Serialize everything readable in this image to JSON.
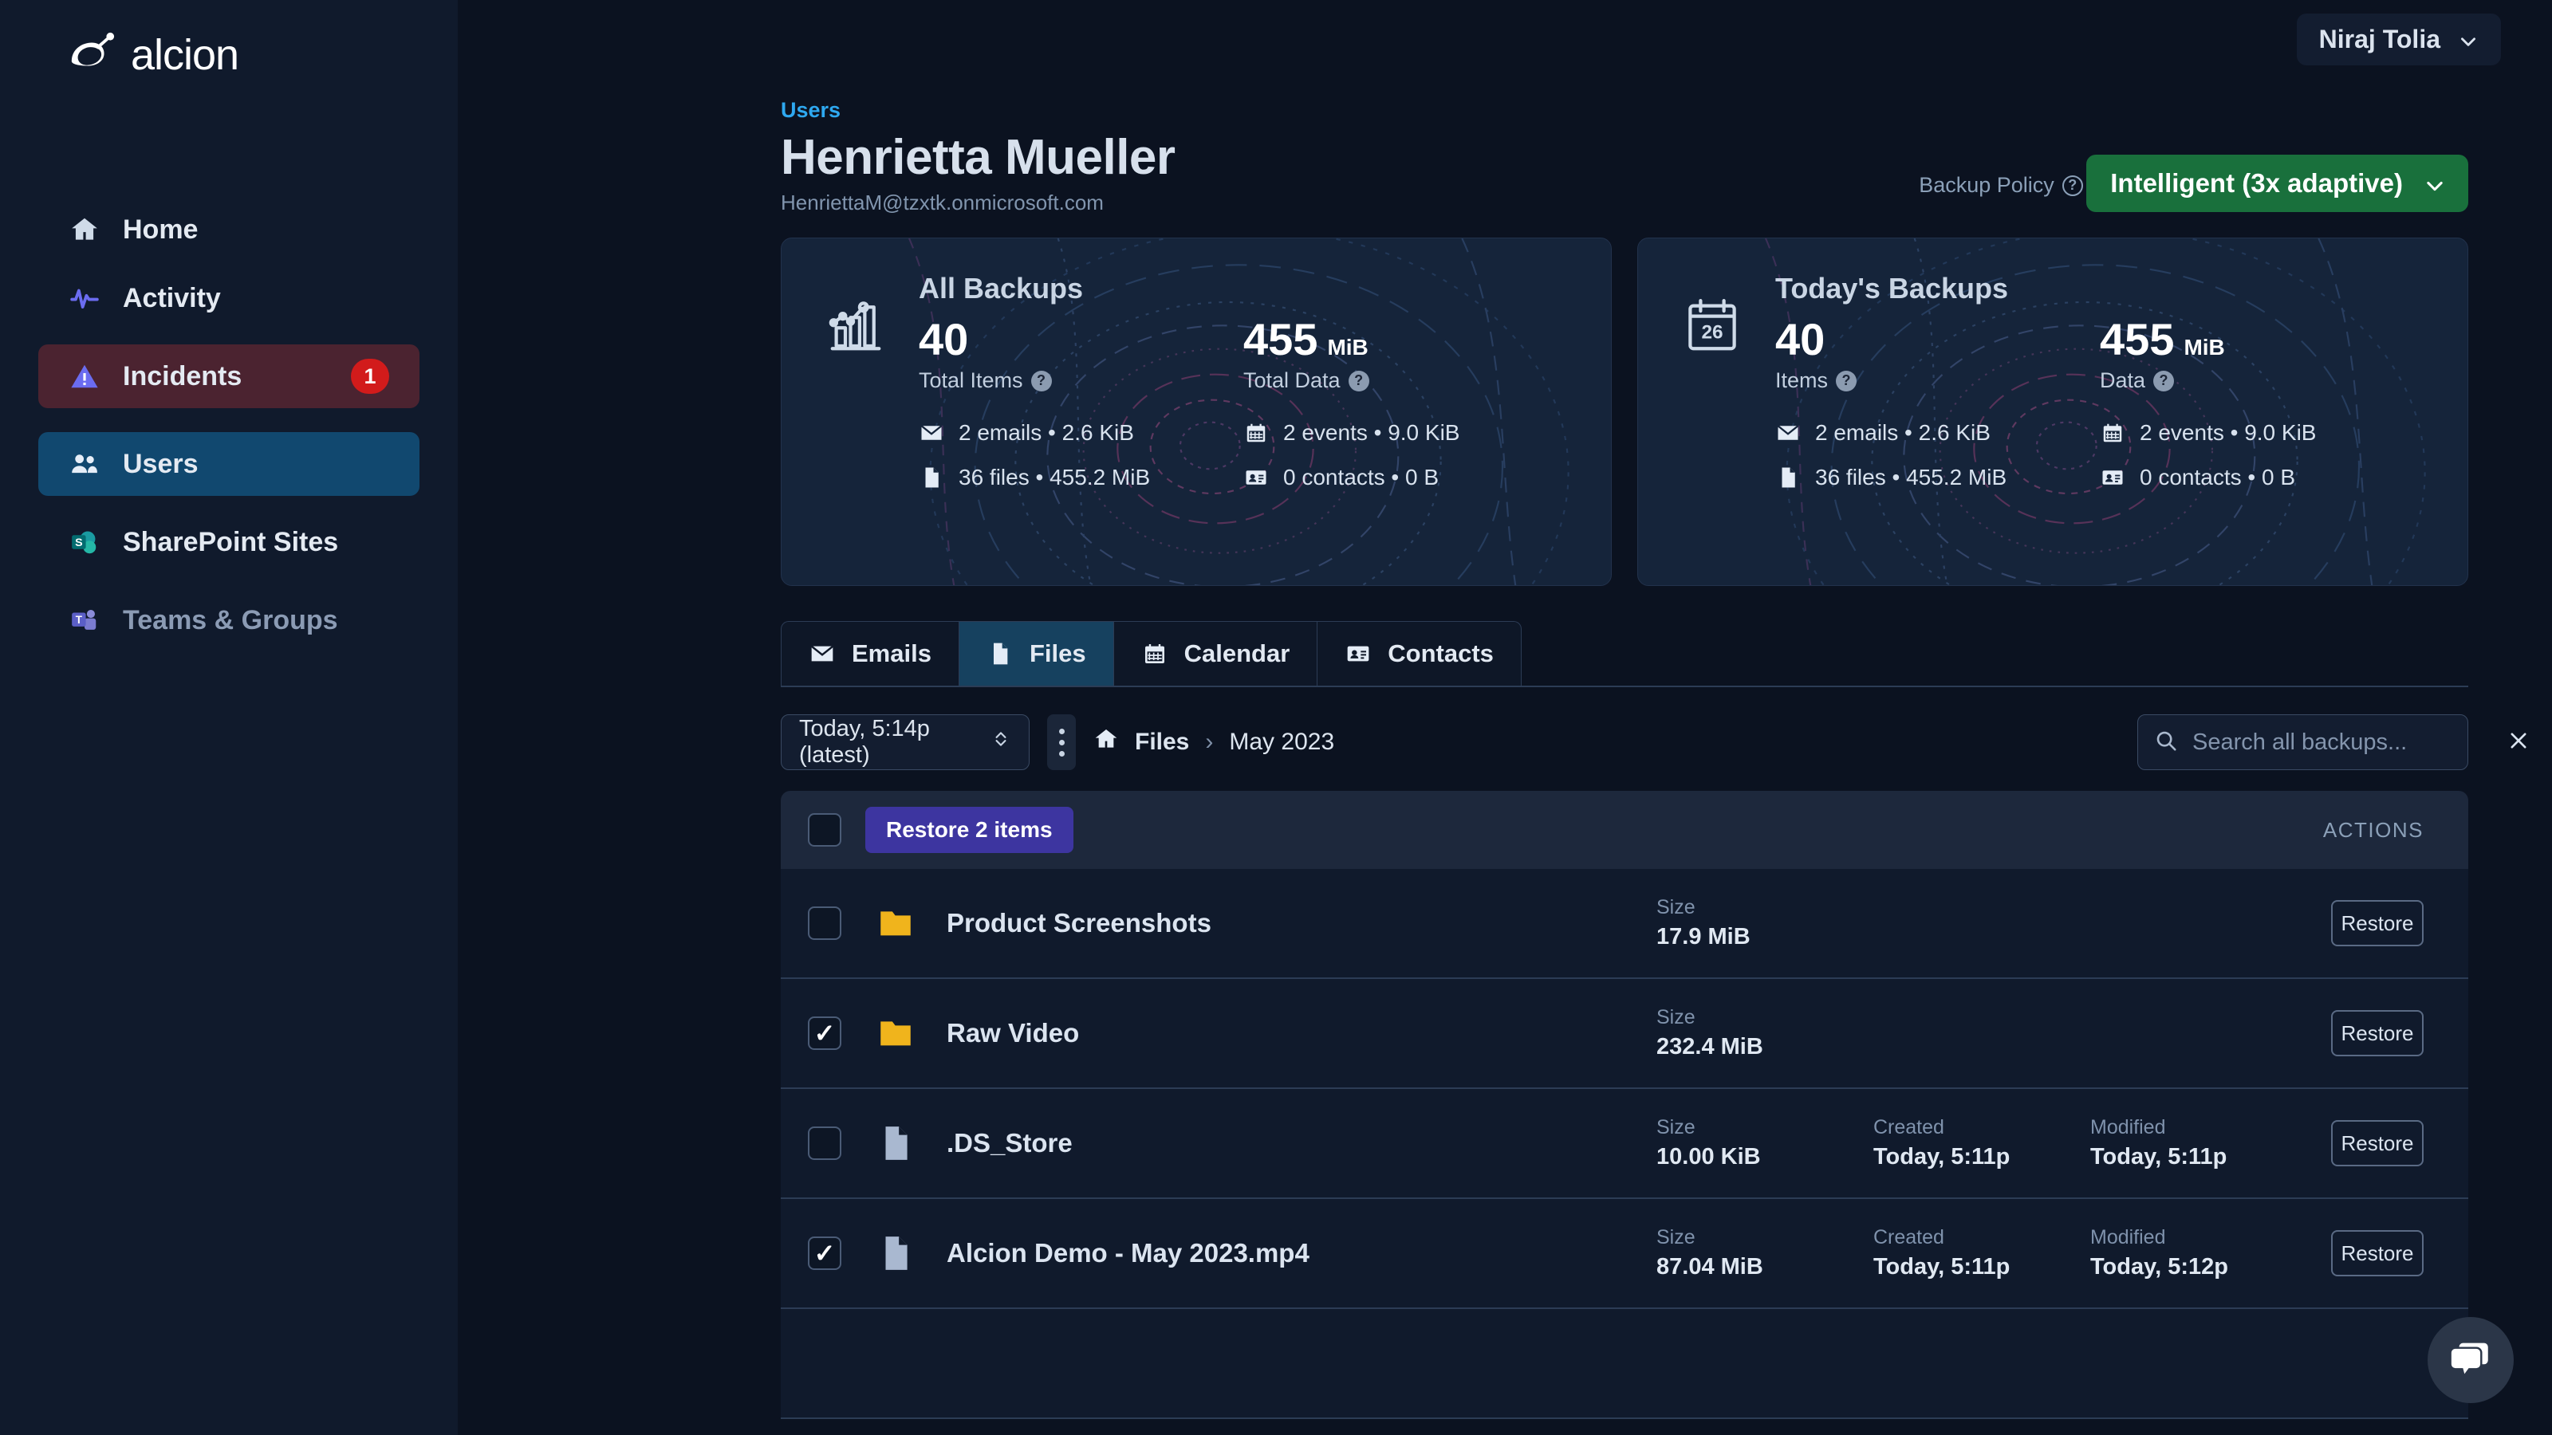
{
  "brand": {
    "name": "alcion",
    "logo_icon": "alcion-logo-icon"
  },
  "sidebar": {
    "items": [
      {
        "label": "Home",
        "icon": "home-icon"
      },
      {
        "label": "Activity",
        "icon": "activity-pulse-icon"
      },
      {
        "label": "Incidents",
        "icon": "warning-triangle-icon",
        "badge": "1"
      },
      {
        "label": "Users",
        "icon": "users-icon"
      },
      {
        "label": "SharePoint Sites",
        "icon": "sharepoint-icon"
      },
      {
        "label": "Teams & Groups",
        "icon": "teams-icon"
      }
    ]
  },
  "topbar": {
    "user_name": "Niraj Tolia",
    "chevron_icon": "chevron-down-icon"
  },
  "header": {
    "breadcrumb": "Users",
    "title": "Henrietta Mueller",
    "email": "HenriettaM@tzxtk.onmicrosoft.com",
    "policy_label": "Backup Policy",
    "policy_help_icon": "help-circle-icon",
    "policy_value": "Intelligent (3x adaptive)"
  },
  "cards": [
    {
      "title": "All Backups",
      "icon": "bar-chart-trend-icon",
      "metrics": [
        {
          "value": "40",
          "unit": "",
          "caption": "Total Items",
          "help_icon": "help-circle-icon"
        },
        {
          "value": "455",
          "unit": "MiB",
          "caption": "Total Data",
          "help_icon": "help-circle-icon"
        }
      ],
      "breakdown": [
        {
          "icon": "envelope-icon",
          "text": "2 emails • 2.6 KiB"
        },
        {
          "icon": "calendar-icon",
          "text": "2 events • 9.0 KiB"
        },
        {
          "icon": "file-icon",
          "text": "36 files • 455.2 MiB"
        },
        {
          "icon": "contact-card-icon",
          "text": "0 contacts • 0 B"
        }
      ]
    },
    {
      "title": "Today's Backups",
      "icon": "calendar-26-icon",
      "metrics": [
        {
          "value": "40",
          "unit": "",
          "caption": "Items",
          "help_icon": "help-circle-icon"
        },
        {
          "value": "455",
          "unit": "MiB",
          "caption": "Data",
          "help_icon": "help-circle-icon"
        }
      ],
      "breakdown": [
        {
          "icon": "envelope-icon",
          "text": "2 emails • 2.6 KiB"
        },
        {
          "icon": "calendar-icon",
          "text": "2 events • 9.0 KiB"
        },
        {
          "icon": "file-icon",
          "text": "36 files • 455.2 MiB"
        },
        {
          "icon": "contact-card-icon",
          "text": "0 contacts • 0 B"
        }
      ]
    }
  ],
  "tabs": [
    {
      "label": "Emails",
      "icon": "envelope-icon",
      "active": false
    },
    {
      "label": "Files",
      "icon": "file-icon",
      "active": true
    },
    {
      "label": "Calendar",
      "icon": "calendar-icon",
      "active": false
    },
    {
      "label": "Contacts",
      "icon": "contact-card-icon",
      "active": false
    }
  ],
  "toolbar": {
    "snapshot_value": "Today, 5:14p (latest)",
    "kebab_icon": "more-vertical-icon",
    "breadcrumb": [
      "Files",
      "May 2023"
    ],
    "breadcrumb_home_icon": "home-icon",
    "breadcrumb_separator": "›",
    "search_placeholder": "Search all backups...",
    "search_value": "",
    "search_icon": "search-icon",
    "clear_icon": "close-icon"
  },
  "table": {
    "select_all_checked": false,
    "bulk_action_label": "Restore 2 items",
    "actions_header": "ACTIONS",
    "restore_label": "Restore",
    "columns": {
      "size": "Size",
      "created": "Created",
      "modified": "Modified"
    },
    "rows": [
      {
        "checked": false,
        "icon": "folder-icon",
        "name": "Product Screenshots",
        "size": "17.9 MiB",
        "created": "",
        "modified": ""
      },
      {
        "checked": true,
        "icon": "folder-icon",
        "name": "Raw Video",
        "size": "232.4 MiB",
        "created": "",
        "modified": ""
      },
      {
        "checked": false,
        "icon": "file-icon",
        "name": ".DS_Store",
        "size": "10.00 KiB",
        "created": "Today, 5:11p",
        "modified": "Today, 5:11p"
      },
      {
        "checked": true,
        "icon": "file-icon",
        "name": "Alcion Demo - May 2023.mp4",
        "size": "87.04 MiB",
        "created": "Today, 5:11p",
        "modified": "Today, 5:12p"
      }
    ]
  },
  "chat": {
    "icon": "chat-bubble-icon"
  },
  "colors": {
    "app_bg": "#0b1220",
    "sidebar_bg": "#101a2c",
    "accent_blue": "#2ea8f0",
    "active_nav": "#11486f",
    "incident_nav": "#4b2330",
    "badge_red": "#d21b1b",
    "policy_green": "#19703c",
    "bulk_purple": "#3d35a0",
    "folder_yellow": "#f0b41c",
    "card_bg": "#15243a"
  }
}
